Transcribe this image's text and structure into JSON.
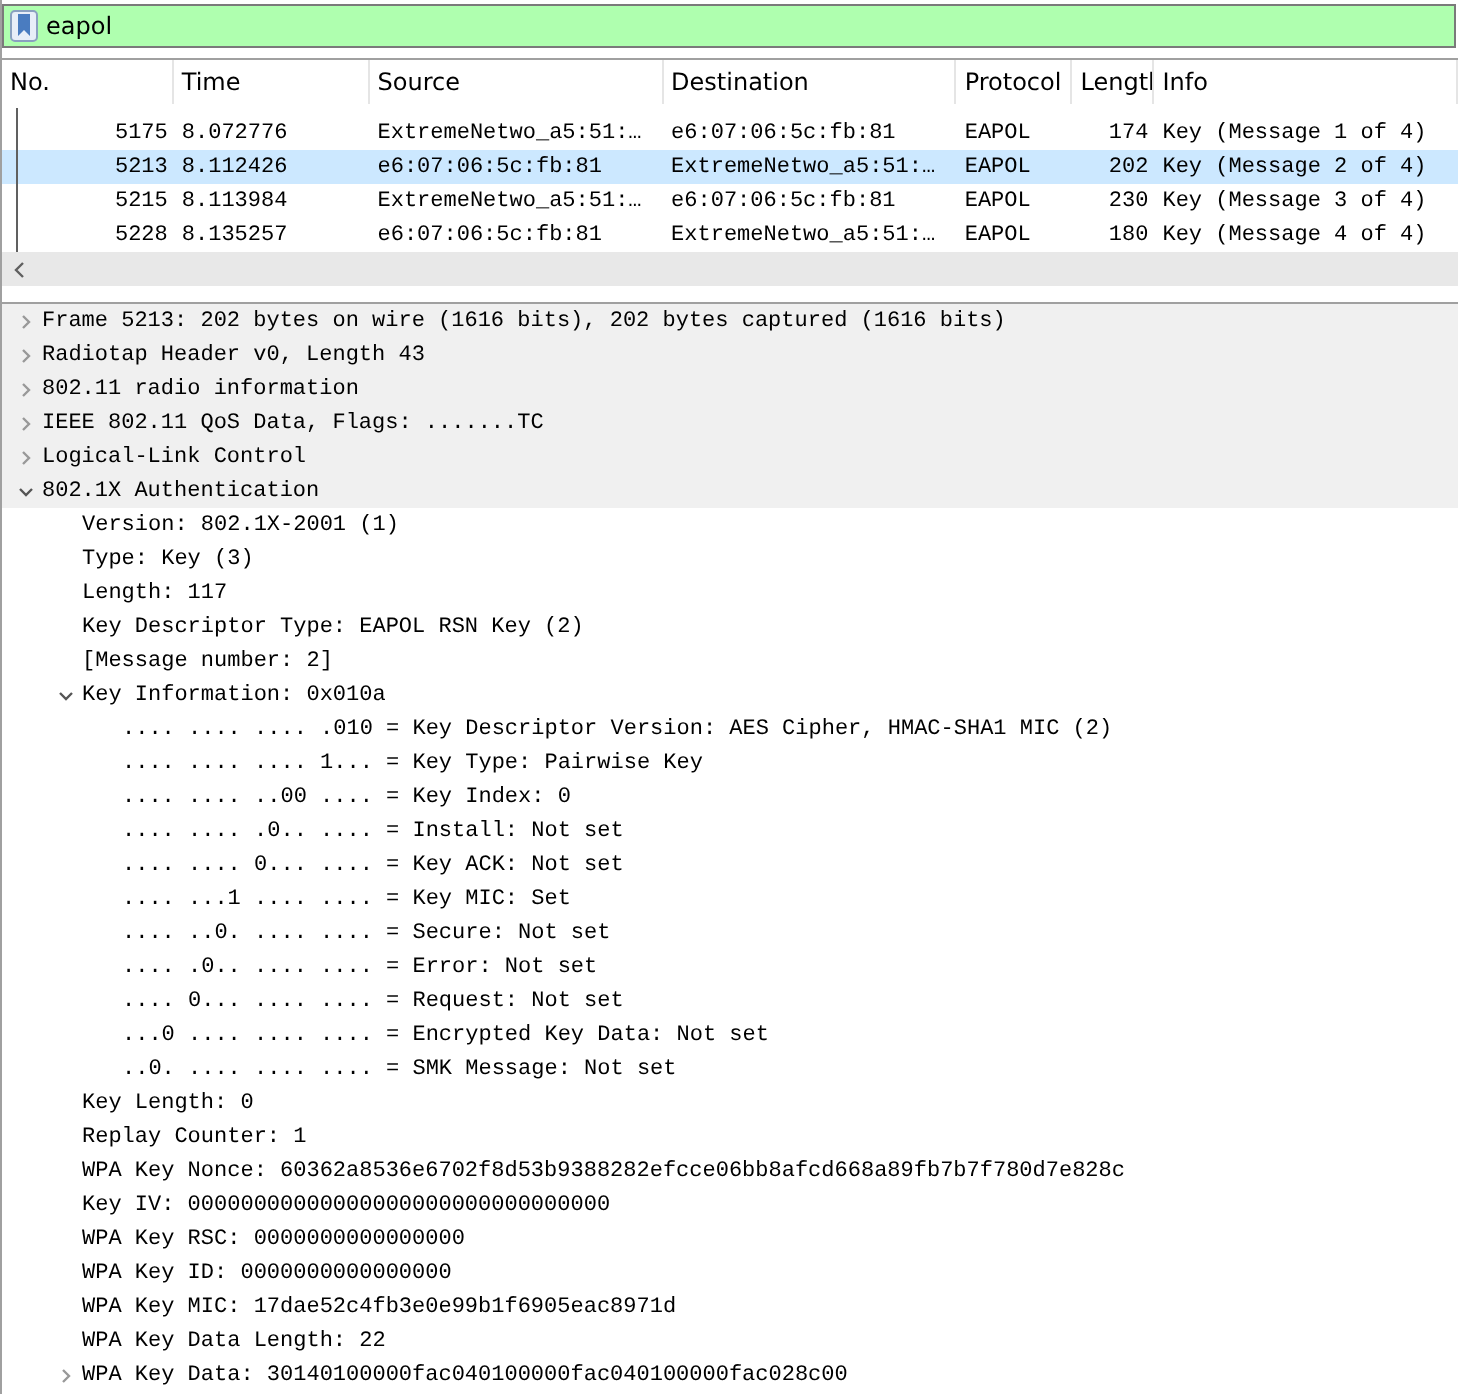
{
  "filter": {
    "value": "eapol"
  },
  "packet_list": {
    "columns": [
      "No.",
      "Time",
      "Source",
      "Destination",
      "Protocol",
      "Lengtl",
      "Info"
    ],
    "rows": [
      {
        "selected": false,
        "cells": [
          "5175",
          "8.072776",
          "ExtremeNetwo_a5:51:…",
          "e6:07:06:5c:fb:81",
          "EAPOL",
          "174",
          "Key (Message 1 of 4)"
        ]
      },
      {
        "selected": true,
        "cells": [
          "5213",
          "8.112426",
          "e6:07:06:5c:fb:81",
          "ExtremeNetwo_a5:51:…",
          "EAPOL",
          "202",
          "Key (Message 2 of 4)"
        ]
      },
      {
        "selected": false,
        "cells": [
          "5215",
          "8.113984",
          "ExtremeNetwo_a5:51:…",
          "e6:07:06:5c:fb:81",
          "EAPOL",
          "230",
          "Key (Message 3 of 4)"
        ]
      },
      {
        "selected": false,
        "cells": [
          "5228",
          "8.135257",
          "e6:07:06:5c:fb:81",
          "ExtremeNetwo_a5:51:…",
          "EAPOL",
          "180",
          "Key (Message 4 of 4)"
        ]
      }
    ]
  },
  "details": [
    {
      "text": "Frame 5213: 202 bytes on wire (1616 bits), 202 bytes captured (1616 bits)",
      "expanded": false
    },
    {
      "text": "Radiotap Header v0, Length 43",
      "expanded": false
    },
    {
      "text": "802.11 radio information",
      "expanded": false
    },
    {
      "text": "IEEE 802.11 QoS Data, Flags: .......TC",
      "expanded": false
    },
    {
      "text": "Logical-Link Control",
      "expanded": false
    },
    {
      "text": "802.1X Authentication",
      "expanded": true,
      "children": [
        {
          "text": "Version: 802.1X-2001 (1)"
        },
        {
          "text": "Type: Key (3)"
        },
        {
          "text": "Length: 117"
        },
        {
          "text": "Key Descriptor Type: EAPOL RSN Key (2)"
        },
        {
          "text": "[Message number: 2]"
        },
        {
          "text": "Key Information: 0x010a",
          "expanded": true,
          "children": [
            {
              "text": ".... .... .... .010 = Key Descriptor Version: AES Cipher, HMAC-SHA1 MIC (2)"
            },
            {
              "text": ".... .... .... 1... = Key Type: Pairwise Key"
            },
            {
              "text": ".... .... ..00 .... = Key Index: 0"
            },
            {
              "text": ".... .... .0.. .... = Install: Not set"
            },
            {
              "text": ".... .... 0... .... = Key ACK: Not set"
            },
            {
              "text": ".... ...1 .... .... = Key MIC: Set"
            },
            {
              "text": ".... ..0. .... .... = Secure: Not set"
            },
            {
              "text": ".... .0.. .... .... = Error: Not set"
            },
            {
              "text": ".... 0... .... .... = Request: Not set"
            },
            {
              "text": "...0 .... .... .... = Encrypted Key Data: Not set"
            },
            {
              "text": "..0. .... .... .... = SMK Message: Not set"
            }
          ]
        },
        {
          "text": "Key Length: 0"
        },
        {
          "text": "Replay Counter: 1"
        },
        {
          "text": "WPA Key Nonce: 60362a8536e6702f8d53b9388282efcce06bb8afcd668a89fb7b7f780d7e828c"
        },
        {
          "text": "Key IV: 00000000000000000000000000000000"
        },
        {
          "text": "WPA Key RSC: 0000000000000000"
        },
        {
          "text": "WPA Key ID: 0000000000000000"
        },
        {
          "text": "WPA Key MIC: 17dae52c4fb3e0e99b1f6905eac8971d"
        },
        {
          "text": "WPA Key Data Length: 22"
        },
        {
          "text": "WPA Key Data: 30140100000fac040100000fac040100000fac028c00",
          "expanded": false
        }
      ]
    }
  ]
}
